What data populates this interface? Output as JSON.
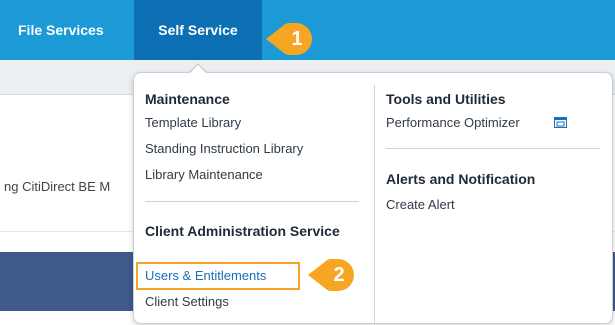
{
  "navbar": {
    "items": [
      {
        "label": "File Services"
      },
      {
        "label": "Self Service"
      }
    ]
  },
  "content": {
    "row_text": "ng CitiDirect BE M"
  },
  "menu": {
    "left_column": {
      "maintenance_heading": "Maintenance",
      "maintenance_links": [
        "Template Library",
        "Standing Instruction Library",
        "Library Maintenance"
      ],
      "client_admin_heading": "Client Administration Service",
      "client_admin_links": [
        "Users & Entitlements",
        "Client Settings"
      ]
    },
    "right_column": {
      "tools_heading": "Tools and Utilities",
      "tools_links": [
        "Performance Optimizer"
      ],
      "tools_link_icon": "external-window-icon",
      "alerts_heading": "Alerts and Notification",
      "alerts_links": [
        "Create Alert"
      ]
    }
  },
  "callouts": [
    {
      "number": "1"
    },
    {
      "number": "2"
    }
  ],
  "colors": {
    "navbar": "#1b9ad6",
    "navbar_active": "#0c6fb4",
    "callout": "#f6a623",
    "link_highlight": "#1a6fb8"
  }
}
